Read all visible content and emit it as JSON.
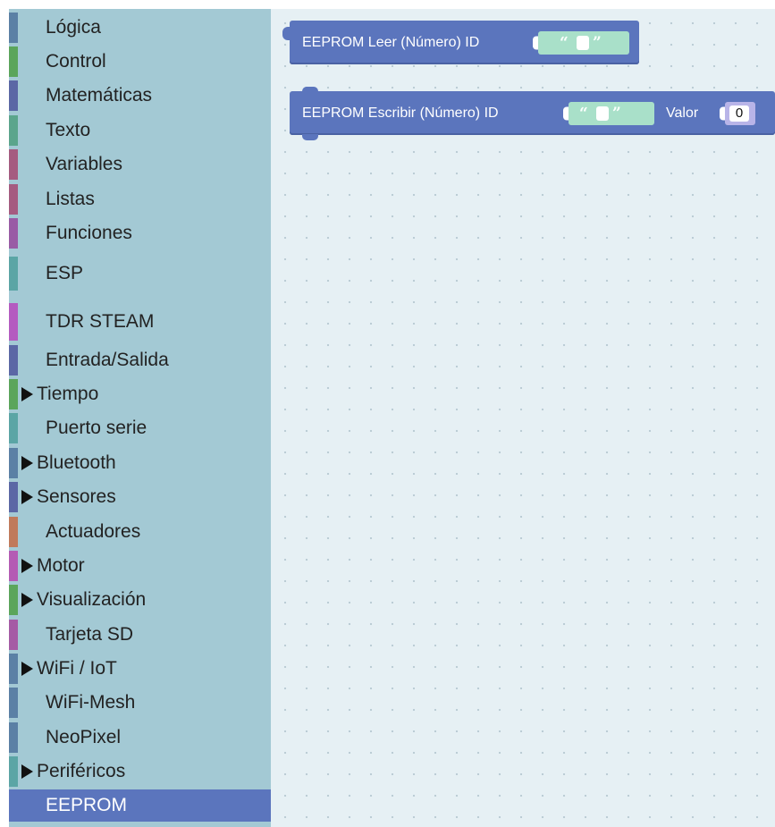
{
  "toolbox": {
    "categories": [
      {
        "label": "Lógica",
        "color": "#5b80a5",
        "arrow": false
      },
      {
        "label": "Control",
        "color": "#5ba55b",
        "arrow": false
      },
      {
        "label": "Matemáticas",
        "color": "#5b67a5",
        "arrow": false
      },
      {
        "label": "Texto",
        "color": "#5ba58c",
        "arrow": false
      },
      {
        "label": "Variables",
        "color": "#a55b80",
        "arrow": false
      },
      {
        "label": "Listas",
        "color": "#a55b80",
        "arrow": false
      },
      {
        "label": "Funciones",
        "color": "#995ba5",
        "arrow": false
      },
      {
        "label": "ESP",
        "color": "#5ba5a5",
        "arrow": false
      },
      {
        "label": "TDR STEAM",
        "color": "#b45bc0",
        "arrow": false
      },
      {
        "label": "Entrada/Salida",
        "color": "#5b67a5",
        "arrow": false
      },
      {
        "label": "Tiempo",
        "color": "#5ba55b",
        "arrow": true
      },
      {
        "label": "Puerto serie",
        "color": "#5ba5a5",
        "arrow": false
      },
      {
        "label": "Bluetooth",
        "color": "#5b80a5",
        "arrow": true
      },
      {
        "label": "Sensores",
        "color": "#5b67a5",
        "arrow": true
      },
      {
        "label": "Actuadores",
        "color": "#c07a5b",
        "arrow": false
      },
      {
        "label": "Motor",
        "color": "#b45bb4",
        "arrow": true
      },
      {
        "label": "Visualización",
        "color": "#5ba55b",
        "arrow": true
      },
      {
        "label": "Tarjeta SD",
        "color": "#a55ba5",
        "arrow": false
      },
      {
        "label": "WiFi / IoT",
        "color": "#5b80a5",
        "arrow": true
      },
      {
        "label": "WiFi-Mesh",
        "color": "#5b80a5",
        "arrow": false
      },
      {
        "label": "NeoPixel",
        "color": "#5b80a5",
        "arrow": false
      },
      {
        "label": "Periféricos",
        "color": "#5ba5a5",
        "arrow": true
      },
      {
        "label": "EEPROM",
        "color": "#5b75bd",
        "arrow": false,
        "selected": true
      }
    ]
  },
  "workspace": {
    "blocks": [
      {
        "kind": "eeprom-read",
        "text": "EEPROM Leer (Número)  ID"
      },
      {
        "kind": "eeprom-write",
        "text": "EEPROM Escribir (Número)  ID",
        "value_label": "Valor",
        "value": "0"
      }
    ],
    "string_quote_open": "“",
    "string_quote_close": "”"
  },
  "colors": {
    "toolbox_bg": "#a3c9d4",
    "workspace_bg": "#e6f0f4",
    "block_color": "#5b75bd",
    "string_color": "#a9e0c9",
    "number_color": "#b8b4e8"
  }
}
